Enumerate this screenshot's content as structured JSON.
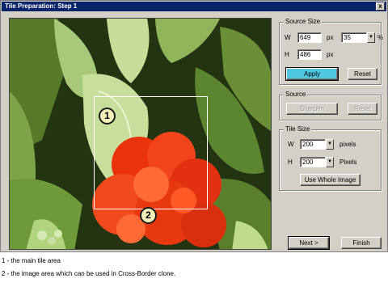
{
  "window": {
    "title": "Tile Preparation: Step 1",
    "close_label": "x"
  },
  "markers": {
    "one": "1",
    "two": "2"
  },
  "source_size": {
    "title": "Source Size",
    "w_label": "W",
    "w_value": "649",
    "w_unit": "px",
    "h_label": "H",
    "h_value": "486",
    "h_unit": "px",
    "percent_value": "35",
    "percent_unit": "%",
    "apply_label": "Apply",
    "reset_label": "Reset"
  },
  "source": {
    "title": "Source",
    "sharpen_label": "Sharpen",
    "reset_label": "Reset"
  },
  "tile_size": {
    "title": "Tile Size",
    "w_label": "W",
    "w_value": "200",
    "w_unit": "pixels",
    "h_label": "H",
    "h_value": "200",
    "h_unit": "Pixels",
    "whole_image_label": "Use Whole Image"
  },
  "footer": {
    "next_label": "Next >",
    "finish_label": "Finish"
  },
  "captions": [
    "1 - the main tile area",
    "2 - the image area which can be used in Cross-Border clone."
  ],
  "icons": {
    "close": "close-icon",
    "dropdown": "dropdown-arrow-icon"
  },
  "colors": {
    "title_bar": "#0a246a",
    "apply_button": "#4fc7e0",
    "marker_fill": "#f3efb6",
    "dialog": "#d4d0c8"
  }
}
